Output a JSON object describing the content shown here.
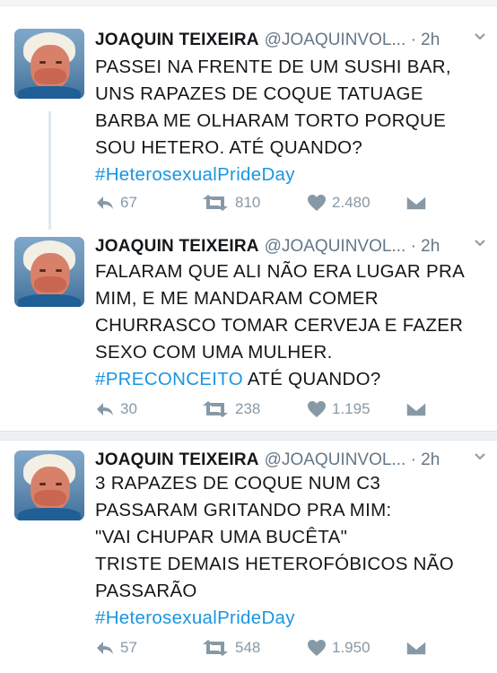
{
  "tweets": [
    {
      "author_name": "JOAQUIN TEIXEIRA",
      "handle": "@JOAQUINVOL...",
      "time": "· 2h",
      "lines": [
        {
          "text": "PASSEI NA FRENTE DE UM SUSHI BAR,",
          "hashtag": "",
          "after": ""
        },
        {
          "text": "UNS RAPAZES DE COQUE TATUAGE",
          "hashtag": "",
          "after": ""
        },
        {
          "text": "BARBA ME OLHARAM TORTO PORQUE",
          "hashtag": "",
          "after": ""
        },
        {
          "text": "SOU HETERO. ATÉ QUANDO?",
          "hashtag": "",
          "after": ""
        },
        {
          "text": "",
          "hashtag": "#HeterosexualPrideDay",
          "after": ""
        }
      ],
      "replies": "67",
      "retweets": "810",
      "likes": "2.480"
    },
    {
      "author_name": "JOAQUIN TEIXEIRA",
      "handle": "@JOAQUINVOL...",
      "time": "· 2h",
      "lines": [
        {
          "text": "FALARAM QUE ALI NÃO ERA LUGAR PRA",
          "hashtag": "",
          "after": ""
        },
        {
          "text": "MIM, E ME MANDARAM COMER",
          "hashtag": "",
          "after": ""
        },
        {
          "text": "CHURRASCO TOMAR CERVEJA E FAZER",
          "hashtag": "",
          "after": ""
        },
        {
          "text": "SEXO COM UMA MULHER.",
          "hashtag": "",
          "after": ""
        },
        {
          "text": "",
          "hashtag": "#PRECONCEITO",
          "after": " ATÉ QUANDO?"
        }
      ],
      "replies": "30",
      "retweets": "238",
      "likes": "1.195"
    },
    {
      "author_name": "JOAQUIN TEIXEIRA",
      "handle": "@JOAQUINVOL...",
      "time": "· 2h",
      "lines": [
        {
          "text": "3 RAPAZES DE COQUE NUM C3",
          "hashtag": "",
          "after": ""
        },
        {
          "text": "PASSARAM GRITANDO PRA MIM:",
          "hashtag": "",
          "after": ""
        },
        {
          "text": "\"VAI CHUPAR UMA BUCÊTA\"",
          "hashtag": "",
          "after": ""
        },
        {
          "text": "TRISTE DEMAIS HETEROFÓBICOS NÃO",
          "hashtag": "",
          "after": ""
        },
        {
          "text": "PASSARÃO",
          "hashtag": "",
          "after": ""
        },
        {
          "text": "",
          "hashtag": "#HeterosexualPrideDay",
          "after": ""
        }
      ],
      "replies": "57",
      "retweets": "548",
      "likes": "1.950"
    }
  ],
  "colors": {
    "link": "#1b95e0",
    "muted": "#8899a6",
    "text": "#14171a"
  },
  "icons": [
    "reply-icon",
    "retweet-icon",
    "like-icon",
    "direct-message-icon",
    "chevron-down-icon"
  ]
}
